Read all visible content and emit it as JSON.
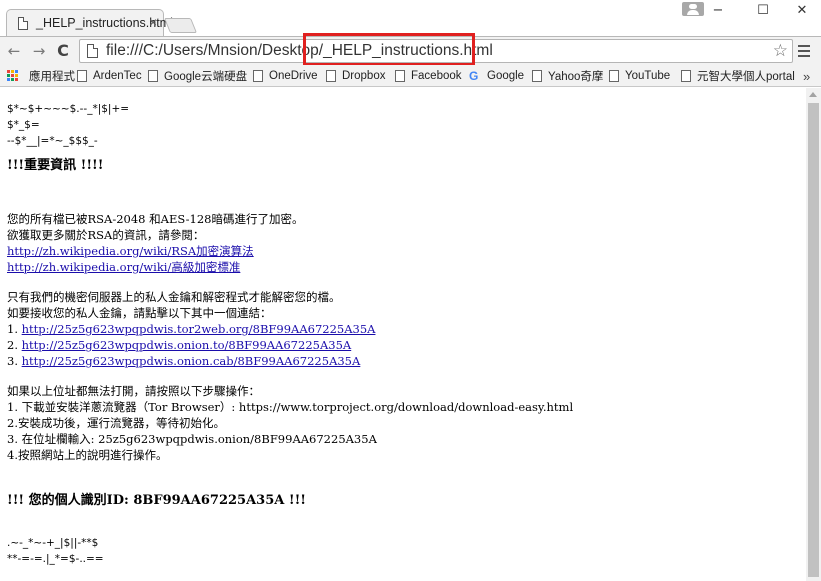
{
  "tab": {
    "title": "_HELP_instructions.html",
    "close": "×"
  },
  "window": {
    "minimize": "−",
    "maximize": "☐",
    "close": "✕"
  },
  "toolbar": {
    "back": "←",
    "forward": "→",
    "reload": "C",
    "url": "file:///C:/Users/Mnsion/Desktop/_HELP_instructions.html",
    "star": "☆"
  },
  "bookmarks": [
    {
      "label": "應用程式",
      "icon": "apps-grid-icon"
    },
    {
      "label": "ArdenTec",
      "icon": "page-icon"
    },
    {
      "label": "Google云端硬盘",
      "icon": "page-icon"
    },
    {
      "label": "OneDrive",
      "icon": "page-icon"
    },
    {
      "label": "Dropbox",
      "icon": "page-icon"
    },
    {
      "label": "Facebook",
      "icon": "page-icon"
    },
    {
      "label": "Google",
      "icon": "google-g-icon"
    },
    {
      "label": "Yahoo奇摩",
      "icon": "page-icon"
    },
    {
      "label": "YouTube",
      "icon": "page-icon"
    },
    {
      "label": "元智大學個人portal",
      "icon": "page-icon"
    }
  ],
  "bookmarks_more": "»",
  "content": {
    "ascii_top": [
      "$*~$+~~~$.--_*|$|+=",
      "$*_$=",
      "--$*__|=*~_$$$_-"
    ],
    "heading_important": "!!!重要資訊 !!!!",
    "para1": [
      "您的所有檔已被RSA-2048 和AES-128暗碼進行了加密。",
      "欲獲取更多關於RSA的資訊，請參閱："
    ],
    "wiki_links": [
      "http://zh.wikipedia.org/wiki/RSA加密演算法",
      "http://zh.wikipedia.org/wiki/高級加密標准"
    ],
    "para2": [
      "只有我們的機密伺服器上的私人金鑰和解密程式才能解密您的檔。",
      "如要接收您的私人金鑰，請點擊以下其中一個連結："
    ],
    "onion_links": [
      {
        "num": "1.",
        "url": "http://25z5g623wpqpdwis.tor2web.org/8BF99AA67225A35A"
      },
      {
        "num": "2.",
        "url": "http://25z5g623wpqpdwis.onion.to/8BF99AA67225A35A"
      },
      {
        "num": "3.",
        "url": "http://25z5g623wpqpdwis.onion.cab/8BF99AA67225A35A"
      }
    ],
    "steps_intro": "如果以上位址都無法打開，請按照以下步驟操作：",
    "steps": [
      "1. 下載並安裝洋蔥流覽器（Tor Browser）: https://www.torproject.org/download/download-easy.html",
      "2.安裝成功後，運行流覽器，等待初始化。",
      "3. 在位址欄輸入: 25z5g623wpqpdwis.onion/8BF99AA67225A35A",
      "4.按照網站上的說明進行操作。"
    ],
    "personal_id": "!!! 您的個人識別ID: 8BF99AA67225A35A !!!",
    "ascii_bottom": [
      ".~-_*~-+_|$||-**$",
      "**-=-=.|_*=$-..=="
    ]
  },
  "colors": {
    "highlight": "#e0201f",
    "link": "#1a0dab"
  }
}
